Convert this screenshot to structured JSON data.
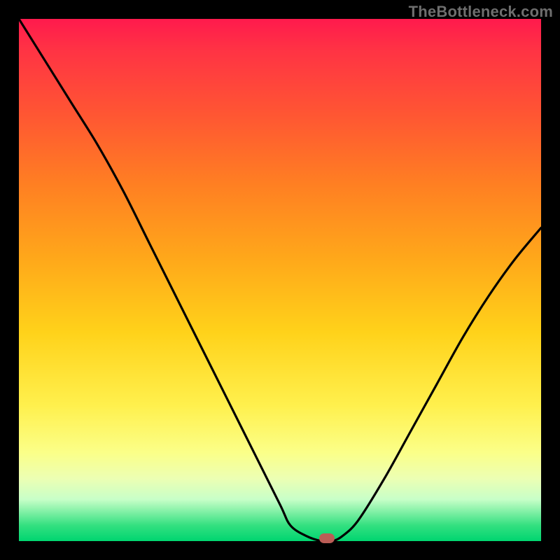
{
  "watermark": "TheBottleneck.com",
  "colors": {
    "frame": "#000000",
    "curve": "#000000",
    "marker": "#bb5d56"
  },
  "chart_data": {
    "type": "line",
    "title": "",
    "xlabel": "",
    "ylabel": "",
    "xlim": [
      0,
      100
    ],
    "ylim": [
      0,
      100
    ],
    "series": [
      {
        "name": "bottleneck-curve",
        "x": [
          0,
          5,
          10,
          15,
          20,
          25,
          30,
          35,
          40,
          45,
          50,
          52,
          55,
          58,
          60,
          62,
          65,
          70,
          75,
          80,
          85,
          90,
          95,
          100
        ],
        "values": [
          100,
          92,
          84,
          76,
          67,
          57,
          47,
          37,
          27,
          17,
          7,
          3,
          1,
          0,
          0,
          1,
          4,
          12,
          21,
          30,
          39,
          47,
          54,
          60
        ]
      }
    ],
    "marker": {
      "x": 59,
      "y": 0.5
    },
    "gradient_stops": [
      {
        "pos": 0,
        "color": "#ff1a4d"
      },
      {
        "pos": 6,
        "color": "#ff3344"
      },
      {
        "pos": 18,
        "color": "#ff5533"
      },
      {
        "pos": 32,
        "color": "#ff8022"
      },
      {
        "pos": 46,
        "color": "#ffa81a"
      },
      {
        "pos": 60,
        "color": "#ffd21a"
      },
      {
        "pos": 74,
        "color": "#fff04d"
      },
      {
        "pos": 83,
        "color": "#fbff88"
      },
      {
        "pos": 88,
        "color": "#ecffb3"
      },
      {
        "pos": 92,
        "color": "#c8ffc8"
      },
      {
        "pos": 97,
        "color": "#33e080"
      },
      {
        "pos": 100,
        "color": "#00d570"
      }
    ]
  }
}
